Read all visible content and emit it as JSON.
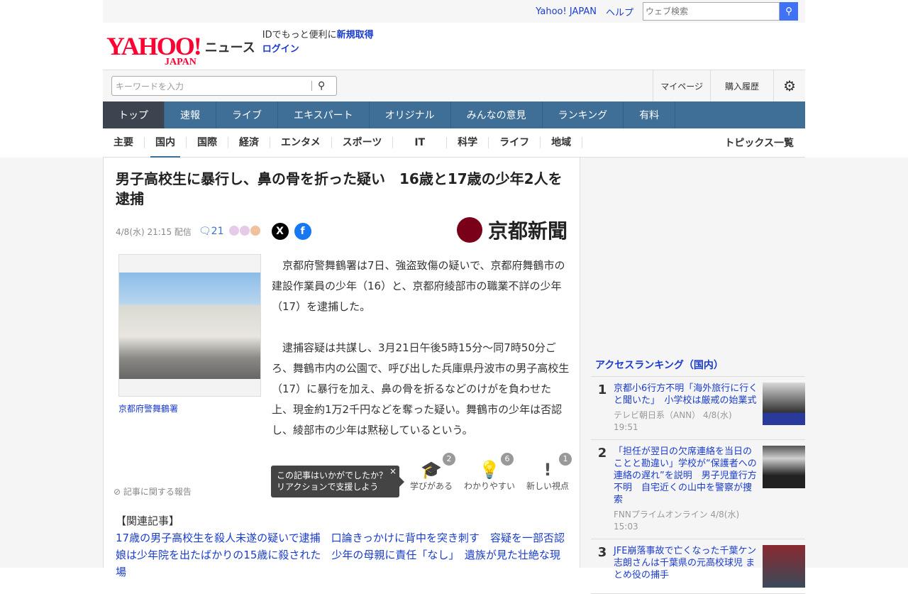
{
  "topbar": {
    "yahoo_link": "Yahoo! JAPAN",
    "help_link": "ヘルプ",
    "web_search_placeholder": "ウェブ検索"
  },
  "header": {
    "logo": "YAHOO! JAPAN",
    "logo_big": "YAHOO!",
    "logo_small": "JAPAN",
    "service": "ニュース",
    "id_text": "IDでもっと便利に",
    "signup": "新規取得",
    "login": "ログイン"
  },
  "search": {
    "placeholder": "キーワードを入力",
    "mypage": "マイページ",
    "history": "購入履歴"
  },
  "gnav": [
    "トップ",
    "速報",
    "ライブ",
    "エキスパート",
    "オリジナル",
    "みんなの意見",
    "ランキング",
    "有料"
  ],
  "snav": [
    "主要",
    "国内",
    "国際",
    "経済",
    "エンタメ",
    "スポーツ",
    "IT",
    "科学",
    "ライフ",
    "地域"
  ],
  "topics_all": "トピックス一覧",
  "article": {
    "title": "男子高校生に暴行し、鼻の骨を折った疑い　16歳と17歳の少年2人を逮捕",
    "date": "4/8(水) 21:15 配信",
    "comments": "21",
    "publisher": "京都新聞",
    "photo_caption": "京都府警舞鶴署",
    "paragraphs": [
      "京都府警舞鶴署は7日、強盗致傷の疑いで、京都府舞鶴市の建設作業員の少年（16）と、京都府綾部市の職業不詳の少年（17）を逮捕した。",
      "逮捕容疑は共謀し、3月21日午後5時15分〜同7時50分ごろ、舞鶴市内の公園で、呼び出した兵庫県丹波市の男子高校生（17）に暴行を加え、鼻の骨を折るなどのけがを負わせた上、現金約1万2千円などを奪った疑い。舞鶴市の少年は否認し、綾部市の少年は黙秘しているという。"
    ],
    "report": "記事に関する報告",
    "tooltip": {
      "line1": "この記事はいかがでしたか？",
      "line2": "リアクションで支援しよう",
      "close": "×"
    },
    "reactions": [
      {
        "label": "学びがある",
        "count": "2"
      },
      {
        "label": "わかりやすい",
        "count": "6"
      },
      {
        "label": "新しい視点",
        "count": "1"
      }
    ],
    "related_heading": "【関連記事】",
    "related": [
      "17歳の男子高校生を殺人未遂の疑いで逮捕　口論きっかけに背中を突き刺す　容疑を一部否認",
      "娘は少年院を出たばかりの15歳に殺された　少年の母親に責任「なし」　遺族が見た壮絶な現場"
    ]
  },
  "ranking": {
    "title": "アクセスランキング（国内）",
    "items": [
      {
        "rank": "1",
        "title": "京都小6行方不明「海外旅行に行くと聞いた」　小学校は厳戒の始業式",
        "source": "テレビ朝日系（ANN）",
        "time": "4/8(水) 19:51"
      },
      {
        "rank": "2",
        "title": "「担任が翌日の欠席連絡を当日のことと勘違い」学校が“保護者への連絡の遅れ”を説明　男子児童行方不明　自宅近くの山中を警察が捜索",
        "source": "FNNプライムオンライン",
        "time": "4/8(水) 15:03"
      },
      {
        "rank": "3",
        "title": "JFE崩落事故で亡くなった千葉ケン志朗さんは千葉県の元高校球児 まとめ役の捕手",
        "source": "",
        "time": ""
      }
    ]
  }
}
